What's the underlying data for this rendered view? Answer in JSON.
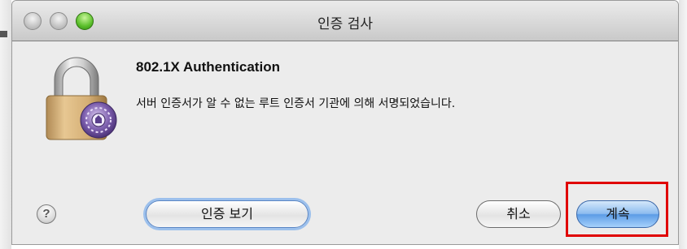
{
  "window": {
    "title": "인증 검사"
  },
  "dialog": {
    "heading": "802.1X Authentication",
    "message": "서버 인증서가 알 수 없는 루트 인증서 기관에 의해 서명되었습니다.",
    "icon": "lock-certificate-icon"
  },
  "buttons": {
    "help_label": "?",
    "show_certificate_label": "인증 보기",
    "cancel_label": "취소",
    "continue_label": "계속"
  },
  "colors": {
    "default_button": "#5c9ce6",
    "highlight_box": "#e00000",
    "window_background": "#ececec"
  }
}
